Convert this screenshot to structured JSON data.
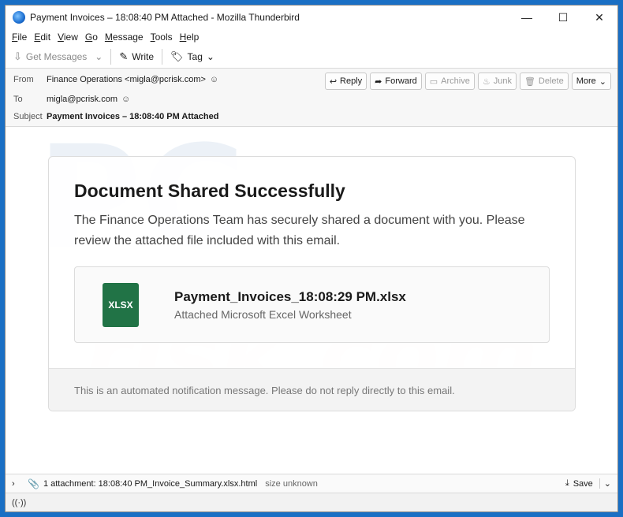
{
  "window": {
    "title": "Payment Invoices – 18:08:40 PM Attached - Mozilla Thunderbird",
    "controls": {
      "minimize": "—",
      "maximize": "☐",
      "close": "✕"
    }
  },
  "menu": {
    "items": [
      "File",
      "Edit",
      "View",
      "Go",
      "Message",
      "Tools",
      "Help"
    ],
    "underline": [
      "F",
      "E",
      "V",
      "G",
      "M",
      "T",
      "H"
    ]
  },
  "toolbar": {
    "get_messages": "Get Messages",
    "write": "Write",
    "tag": "Tag"
  },
  "header": {
    "from_label": "From",
    "from_value": "Finance Operations <migla@pcrisk.com>",
    "to_label": "To",
    "to_value": "migla@pcrisk.com",
    "subject_label": "Subject",
    "subject_value": "Payment Invoices – 18:08:40 PM Attached",
    "actions": {
      "reply": "Reply",
      "forward": "Forward",
      "archive": "Archive",
      "junk": "Junk",
      "delete": "Delete",
      "more": "More"
    }
  },
  "email": {
    "heading": "Document Shared Successfully",
    "body": "The Finance Operations Team has securely shared a document with you. Please review the attached file included with this email.",
    "file_icon_label": "XLSX",
    "file_name": "Payment_Invoices_18:08:29 PM.xlsx",
    "file_desc": "Attached Microsoft Excel Worksheet",
    "footer": "This is an automated notification message. Please do not reply directly to this email."
  },
  "attachments": {
    "summary": "1 attachment: 18:08:40 PM_Invoice_Summary.xlsx.html",
    "size": "size unknown",
    "save": "Save"
  },
  "colors": {
    "excel_green": "#217346",
    "desktop_blue": "#1a6fc4"
  }
}
